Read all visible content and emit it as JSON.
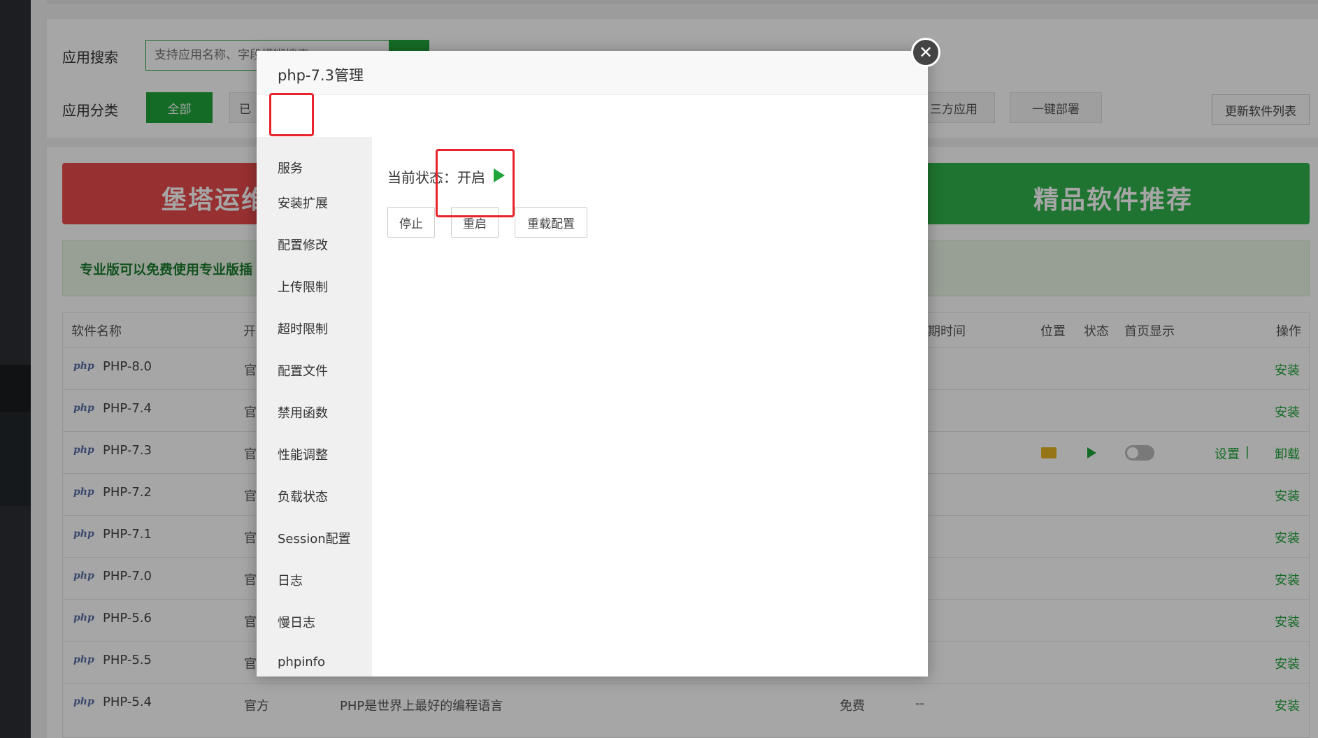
{
  "background": {
    "search_label": "应用搜索",
    "search_placeholder": "支持应用名称、字段模糊搜索",
    "category_label": "应用分类",
    "categories": [
      "全部",
      "已",
      "三方应用",
      "一键部署"
    ],
    "update_button": "更新软件列表",
    "banner_left": "堡塔运维",
    "banner_right": "精品软件推荐",
    "pro_tip": "专业版可以免费使用专业版插",
    "table_headers": {
      "name": "软件名称",
      "dev": "开",
      "expire": "期时间",
      "location": "位置",
      "status": "状态",
      "homepage": "首页显示",
      "action": "操作"
    },
    "rows": [
      {
        "logo": "php",
        "name": "PHP-8.0",
        "source": "官",
        "action": "安装"
      },
      {
        "logo": "php",
        "name": "PHP-7.4",
        "source": "官",
        "action": "安装"
      },
      {
        "logo": "php",
        "name": "PHP-7.3",
        "source": "官",
        "action_set": "设置",
        "action_sep": "|",
        "action_uninstall": "卸载"
      },
      {
        "logo": "php",
        "name": "PHP-7.2",
        "source": "官",
        "action": "安装"
      },
      {
        "logo": "php",
        "name": "PHP-7.1",
        "source": "官",
        "action": "安装"
      },
      {
        "logo": "php",
        "name": "PHP-7.0",
        "source": "官",
        "action": "安装"
      },
      {
        "logo": "php",
        "name": "PHP-5.6",
        "source": "官",
        "action": "安装"
      },
      {
        "logo": "php",
        "name": "PHP-5.5",
        "source": "官",
        "action": "安装"
      },
      {
        "logo": "php",
        "name": "PHP-5.4",
        "source": "官方",
        "desc": "PHP是世界上最好的编程语言",
        "fee": "免费",
        "expire": "--",
        "action": "安装"
      }
    ]
  },
  "modal": {
    "title": "php-7.3管理",
    "nav": [
      "服务",
      "安装扩展",
      "配置修改",
      "上传限制",
      "超时限制",
      "配置文件",
      "禁用函数",
      "性能调整",
      "负载状态",
      "Session配置",
      "日志",
      "慢日志",
      "phpinfo"
    ],
    "status_label": "当前状态：开启",
    "buttons": {
      "stop": "停止",
      "restart": "重启",
      "reload": "重载配置"
    },
    "close_glyph": "✕"
  },
  "colors": {
    "accent": "#20a53a",
    "highlight": "#e8232c"
  }
}
